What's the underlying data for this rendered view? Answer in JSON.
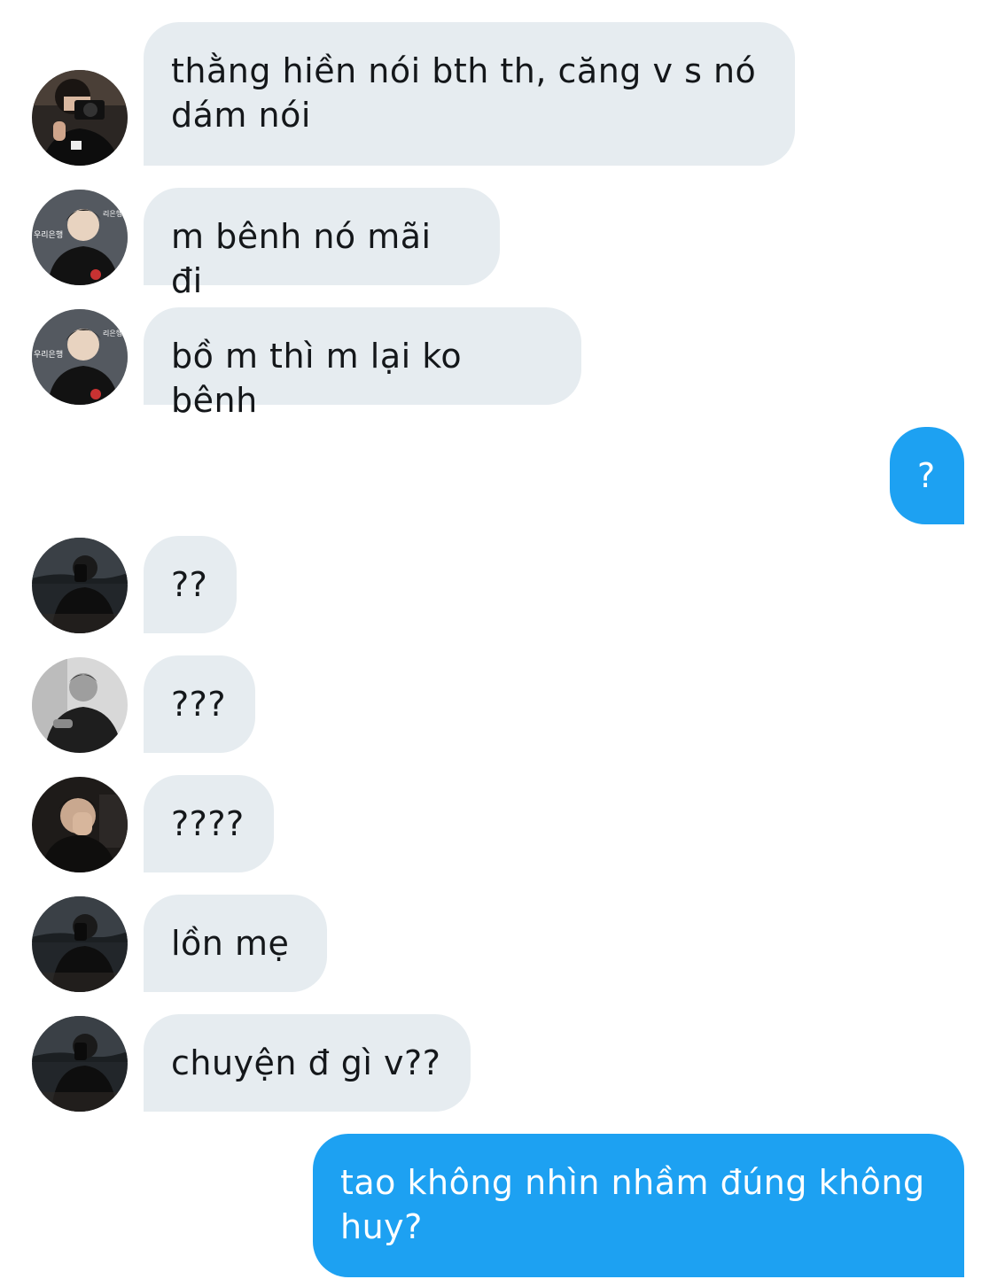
{
  "colors": {
    "incoming_bubble": "#e6ecf0",
    "outgoing_bubble": "#1da1f2",
    "incoming_text": "#14171a",
    "outgoing_text": "#ffffff"
  },
  "messages": [
    {
      "direction": "incoming",
      "avatar": "avatar-camera-photo-icon",
      "text": "thằng hiền nói bth th, căng v s nó\ndám nói"
    },
    {
      "direction": "incoming",
      "avatar": "avatar-press-backdrop-photo-icon",
      "text": "m bênh nó mãi đi"
    },
    {
      "direction": "incoming",
      "avatar": "avatar-press-backdrop-photo-icon",
      "text": "bồ m thì m lại ko bênh"
    },
    {
      "direction": "outgoing",
      "text": "?"
    },
    {
      "direction": "incoming",
      "avatar": "avatar-night-selfie-photo-icon",
      "text": "??"
    },
    {
      "direction": "incoming",
      "avatar": "avatar-monochrome-portrait-icon",
      "text": "???"
    },
    {
      "direction": "incoming",
      "avatar": "avatar-hand-over-face-photo-icon",
      "text": "????"
    },
    {
      "direction": "incoming",
      "avatar": "avatar-night-selfie-photo-icon",
      "text": "lồn mẹ"
    },
    {
      "direction": "incoming",
      "avatar": "avatar-night-selfie-photo-icon",
      "text": "chuyện đ gì v??"
    },
    {
      "direction": "outgoing",
      "text": "tao không nhìn nhầm đúng không\nhuy?"
    }
  ]
}
